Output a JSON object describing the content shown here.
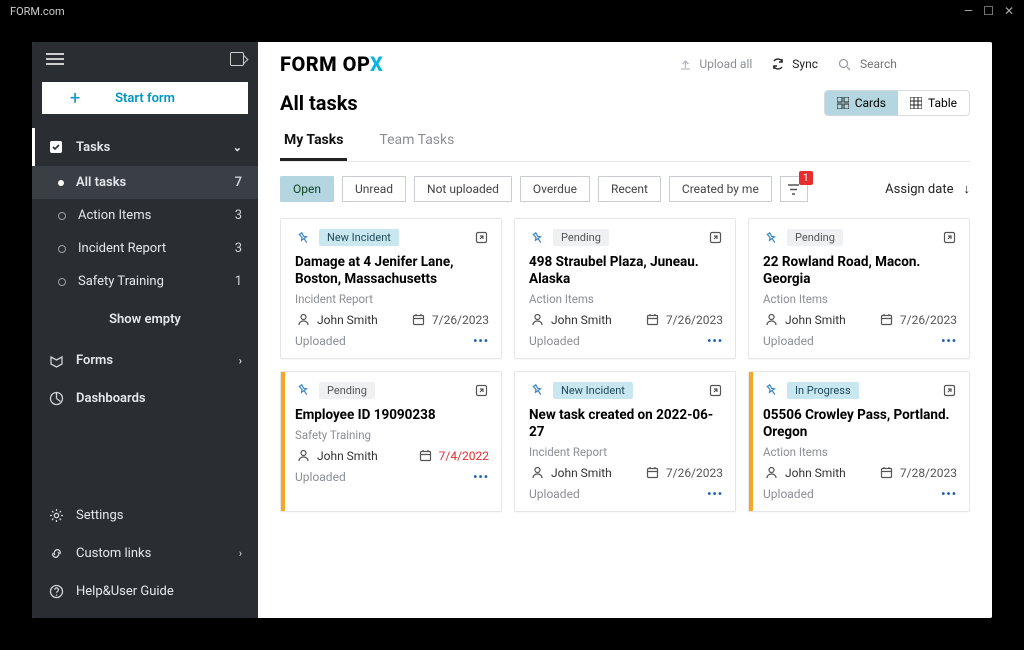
{
  "window": {
    "title": "FORM.com"
  },
  "brand": {
    "p1": "FORM OP",
    "p2": "X"
  },
  "topbar": {
    "upload_all": "Upload all",
    "sync": "Sync",
    "search_placeholder": "Search"
  },
  "sidebar": {
    "start_form": "Start form",
    "tasks_label": "Tasks",
    "items": [
      {
        "label": "All tasks",
        "count": "7",
        "selected": true
      },
      {
        "label": "Action Items",
        "count": "3"
      },
      {
        "label": "Incident Report",
        "count": "3"
      },
      {
        "label": "Safety Training",
        "count": "1"
      }
    ],
    "show_empty": "Show empty",
    "forms": "Forms",
    "dashboards": "Dashboards",
    "settings": "Settings",
    "custom_links": "Custom links",
    "help": "Help&User Guide"
  },
  "page": {
    "title": "All tasks",
    "view_cards": "Cards",
    "view_table": "Table",
    "tab_my": "My Tasks",
    "tab_team": "Team Tasks",
    "filter_open": "Open",
    "filter_unread": "Unread",
    "filter_notup": "Not uploaded",
    "filter_overdue": "Overdue",
    "filter_recent": "Recent",
    "filter_created": "Created by me",
    "filter_badge": "1",
    "sort_label": "Assign date"
  },
  "cards": [
    {
      "status": "New Incident",
      "status_cls": "new",
      "title": "Damage at 4 Jenifer Lane, Boston, Massachusetts",
      "type": "Incident Report",
      "assignee": "John Smith",
      "date": "7/26/2023",
      "overdue": false,
      "upload": "Uploaded",
      "accent": false
    },
    {
      "status": "Pending",
      "status_cls": "",
      "title": "498 Straubel Plaza, Juneau. Alaska",
      "type": "Action Items",
      "assignee": "John Smith",
      "date": "7/26/2023",
      "overdue": false,
      "upload": "Uploaded",
      "accent": false
    },
    {
      "status": "Pending",
      "status_cls": "",
      "title": "22 Rowland Road, Macon. Georgia",
      "type": "Action Items",
      "assignee": "John Smith",
      "date": "7/26/2023",
      "overdue": false,
      "upload": "Uploaded",
      "accent": false
    },
    {
      "status": "Pending",
      "status_cls": "",
      "title": "Employee ID 19090238",
      "type": "Safety Training",
      "assignee": "John Smith",
      "date": "7/4/2022",
      "overdue": true,
      "upload": "Uploaded",
      "accent": true
    },
    {
      "status": "New Incident",
      "status_cls": "new",
      "title": "New task created on 2022-06-27",
      "type": "Incident Report",
      "assignee": "John Smith",
      "date": "7/26/2023",
      "overdue": false,
      "upload": "Uploaded",
      "accent": false
    },
    {
      "status": "In Progress",
      "status_cls": "prog",
      "title": "05506 Crowley Pass, Portland. Oregon",
      "type": "Action Items",
      "assignee": "John Smith",
      "date": "7/28/2023",
      "overdue": false,
      "upload": "Uploaded",
      "accent": true
    }
  ]
}
